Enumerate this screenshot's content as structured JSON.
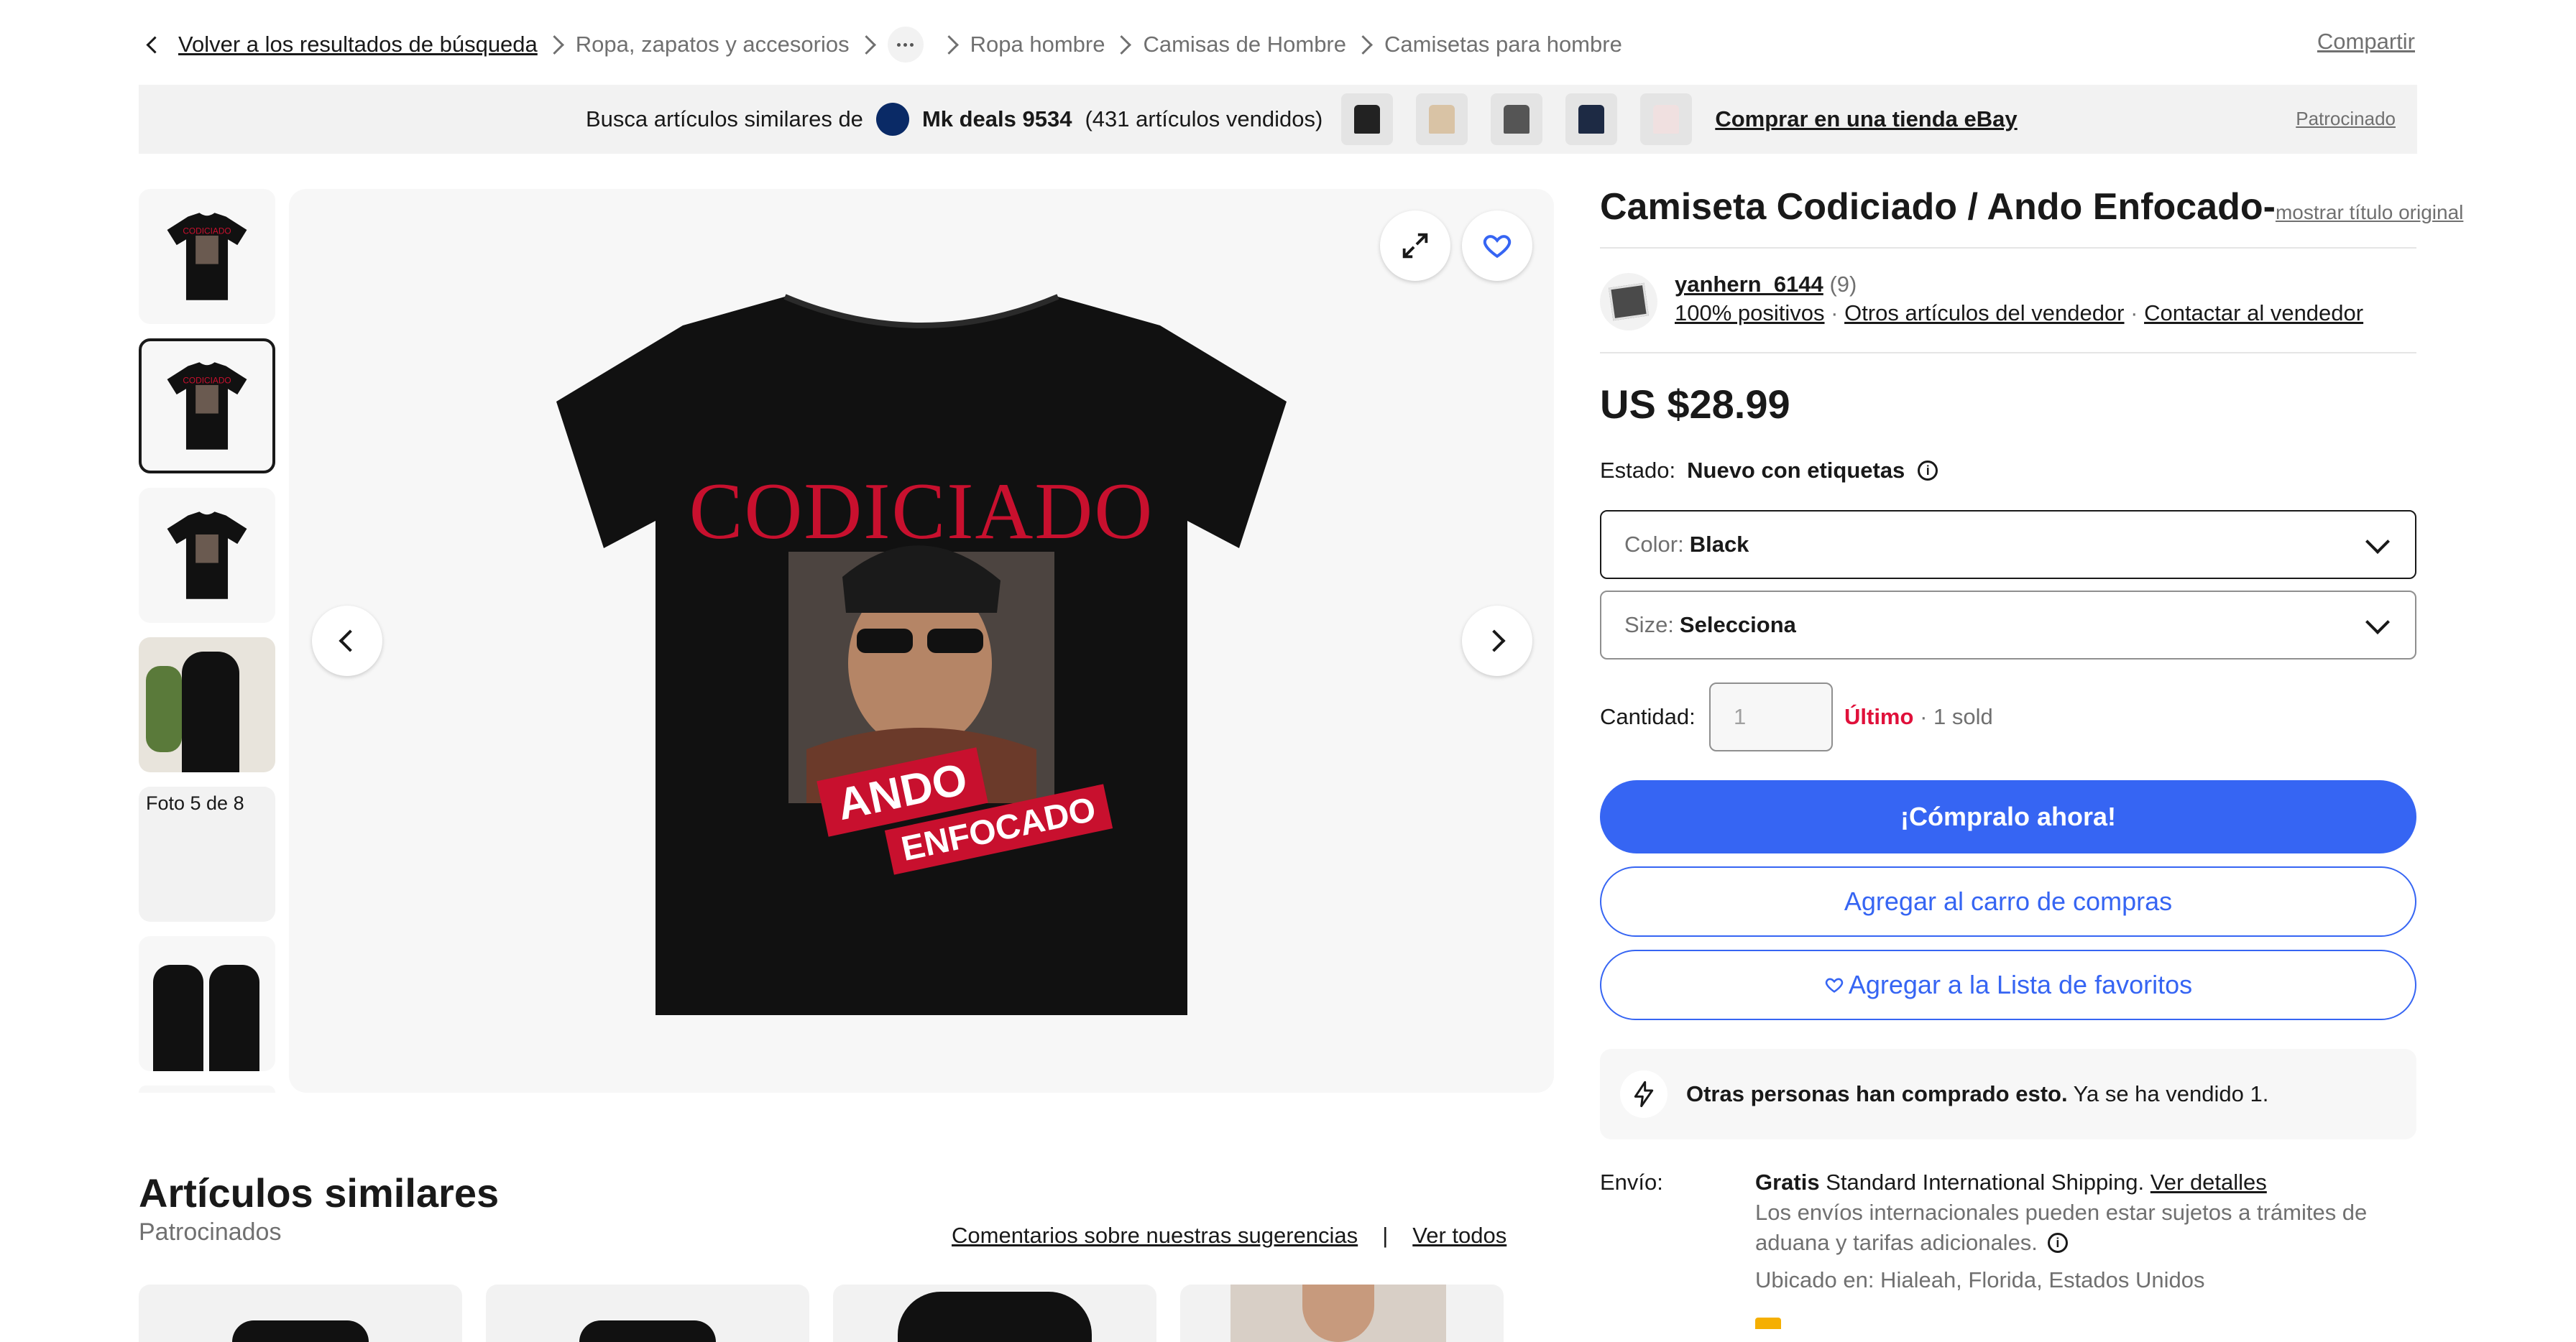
{
  "breadcrumb": {
    "back": "Volver a los resultados de búsqueda",
    "items": [
      "Ropa, zapatos y accesorios",
      "Ropa hombre",
      "Camisas de Hombre",
      "Camisetas para hombre"
    ],
    "share": "Compartir"
  },
  "similar_bar": {
    "prefix": "Busca artículos similares de",
    "store": "Mk deals 9534",
    "sold": "(431 artículos vendidos)",
    "shop_link": "Comprar en una tienda eBay",
    "sponsored": "Patrocinado"
  },
  "gallery": {
    "photo_counter": "Foto 5 de 8"
  },
  "main_image_text": {
    "top": "CODICIADO",
    "line1": "ANDO",
    "line2": "ENFOCADO"
  },
  "product": {
    "title": "Camiseta Codiciado / Ando Enfocado-",
    "title_link": "mostrar título original",
    "seller_name": "yanhern_6144",
    "seller_count": "(9)",
    "seller_feedback": "100% positivos",
    "seller_other": "Otros artículos del vendedor",
    "seller_contact": "Contactar al vendedor",
    "price": "US $28.99",
    "condition_label": "Estado:",
    "condition_value": "Nuevo con etiquetas",
    "color_label": "Color:",
    "color_value": "Black",
    "size_label": "Size:",
    "size_value": "Selecciona",
    "qty_label": "Cantidad:",
    "qty_value": "1",
    "qty_last": "Último",
    "qty_sold": "· 1 sold",
    "buy_now": "¡Cómpralo ahora!",
    "add_cart": "Agregar al carro de compras",
    "add_watch": "Agregar a la Lista de favoritos",
    "promo_bold": "Otras personas han comprado esto.",
    "promo_rest": "Ya se ha vendido 1."
  },
  "shipping": {
    "label": "Envío:",
    "free": "Gratis",
    "service": "Standard International Shipping.",
    "details_link": "Ver detalles",
    "note_line1": "Los envíos internacionales pueden estar sujetos a trámites de",
    "note_line2": "aduana y tarifas adicionales.",
    "location": "Ubicado en: Hialeah, Florida, Estados Unidos"
  },
  "similar": {
    "heading": "Artículos similares",
    "sub": "Patrocinados",
    "feedback": "Comentarios sobre nuestras sugerencias",
    "divider": "|",
    "see_all": "Ver todos"
  },
  "colors": {
    "accent": "#3665f3",
    "last_red": "#e0103a",
    "shirt": "#111111",
    "print_red": "#c8102e"
  }
}
